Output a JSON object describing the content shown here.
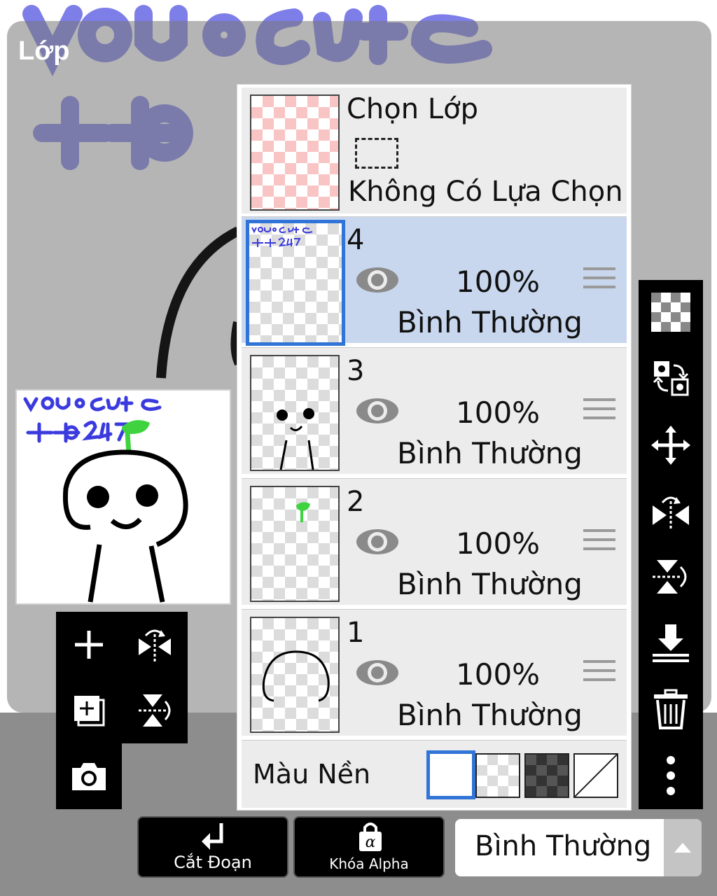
{
  "header": {
    "title": "Lớp"
  },
  "selection_layer": {
    "title": "Chọn Lớp",
    "status": "Không Có Lựa Chọn"
  },
  "layers": [
    {
      "number": "4",
      "opacity": "100%",
      "blend": "Bình Thường",
      "visible": true,
      "active": true
    },
    {
      "number": "3",
      "opacity": "100%",
      "blend": "Bình Thường",
      "visible": true,
      "active": false
    },
    {
      "number": "2",
      "opacity": "100%",
      "blend": "Bình Thường",
      "visible": true,
      "active": false
    },
    {
      "number": "1",
      "opacity": "100%",
      "blend": "Bình Thường",
      "visible": true,
      "active": false
    }
  ],
  "background": {
    "label": "Màu Nền",
    "options": [
      "white",
      "transparent-light",
      "transparent-dark",
      "none"
    ],
    "selected": "white"
  },
  "bottom_bar": {
    "clip_label": "Cắt Đoạn",
    "alpha_lock_label": "Khóa Alpha",
    "blend_mode": "Bình Thường"
  },
  "left_tools": [
    "plus-icon",
    "flip-horizontal-icon",
    "add-layer-icon",
    "flip-vertical-icon",
    "camera-icon"
  ],
  "right_tools": [
    "transparent-icon",
    "swap-icon",
    "move-icon",
    "flip-horizontal-icon",
    "flip-vertical-icon",
    "merge-down-icon",
    "trash-icon",
    "more-icon"
  ],
  "colors": {
    "accent": "#2f74d6",
    "active_row": "#c8d7ee",
    "toolbar": "#000000",
    "handwriting": "#3a3adf",
    "sprout": "#3fd43f"
  }
}
